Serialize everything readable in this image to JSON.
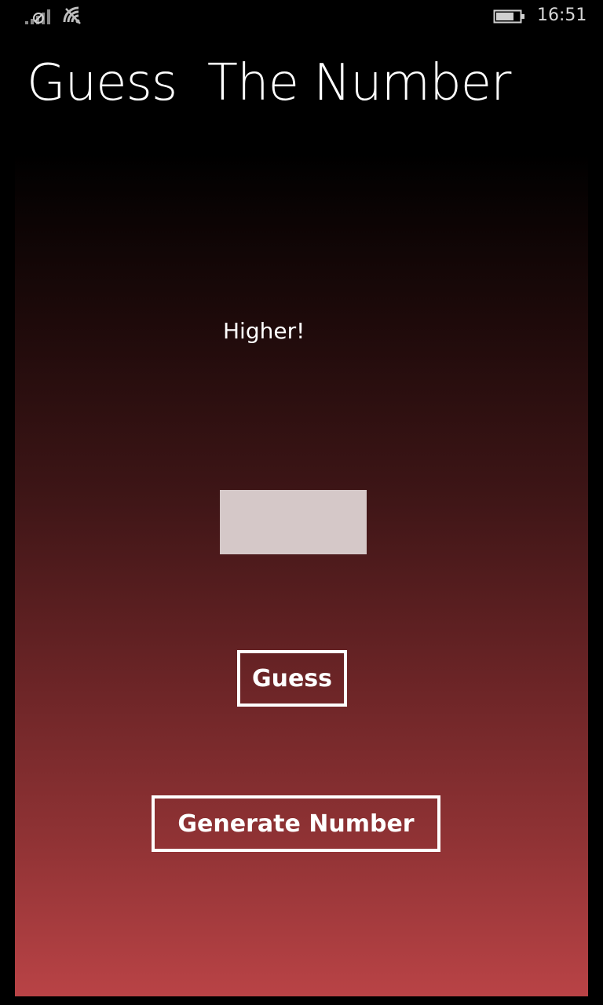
{
  "status_bar": {
    "time": "16:51",
    "signal_icon": "signal-strength-icon",
    "wifi_icon": "wifi-icon",
    "battery_icon": "battery-icon"
  },
  "app": {
    "title": "Guess  The Number"
  },
  "main": {
    "feedback": "Higher!",
    "guess_input": {
      "value": "",
      "placeholder": ""
    },
    "guess_button_label": "Guess",
    "generate_button_label": "Generate Number"
  },
  "colors": {
    "background": "#000000",
    "gradient_top": "#000000",
    "gradient_bottom": "#b94346",
    "input_fill": "#d5c8c8",
    "button_border": "#ffffff",
    "text": "#ffffff"
  }
}
